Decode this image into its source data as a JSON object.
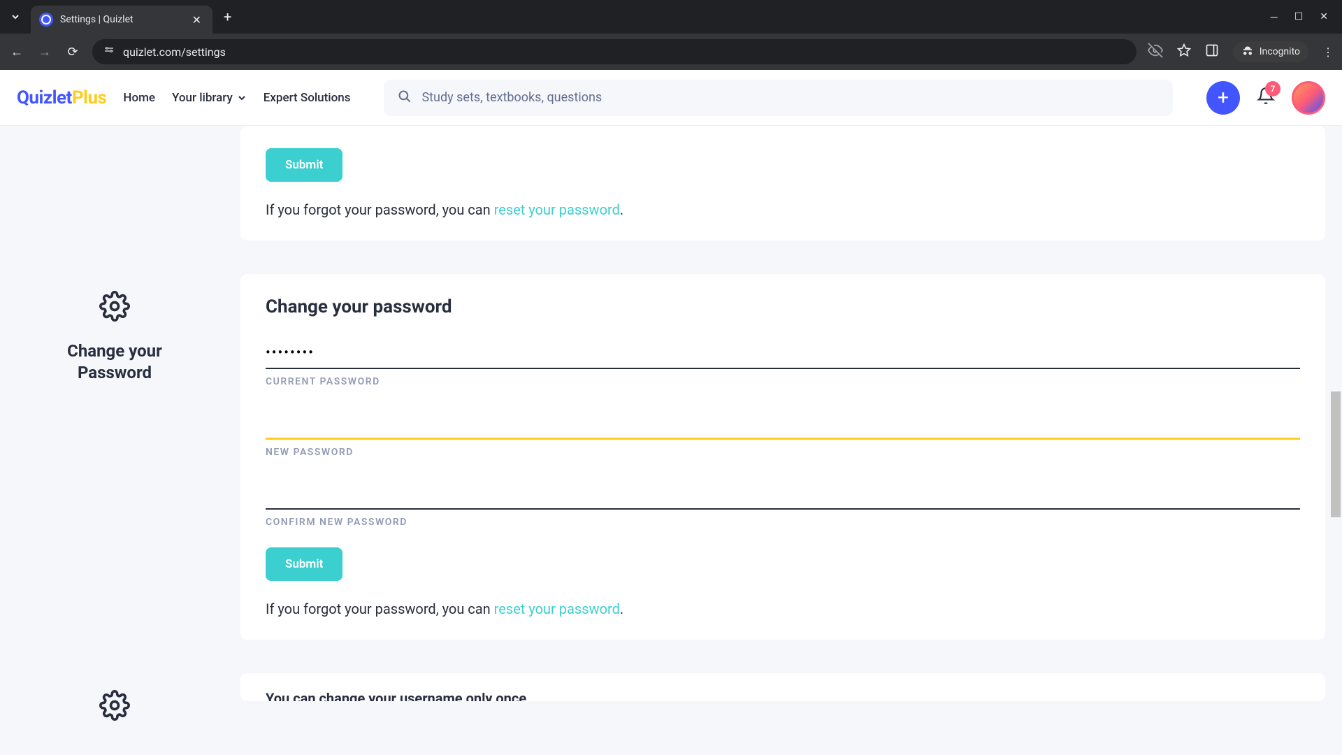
{
  "browser": {
    "tab_title": "Settings | Quizlet",
    "url": "quizlet.com/settings",
    "incognito_label": "Incognito"
  },
  "header": {
    "logo_main": "Quizlet",
    "logo_suffix": "Plus",
    "nav": {
      "home": "Home",
      "library": "Your library",
      "expert": "Expert Solutions"
    },
    "search_placeholder": "Study sets, textbooks, questions",
    "notification_count": "7"
  },
  "partial_card": {
    "submit_label": "Submit",
    "forgot_prefix": "If you forgot your password, you can ",
    "forgot_link": "reset your password",
    "forgot_suffix": "."
  },
  "password_section": {
    "left_title_line1": "Change your",
    "left_title_line2": "Password",
    "heading": "Change your password",
    "current_label": "CURRENT PASSWORD",
    "current_value": "••••••••",
    "new_label": "NEW PASSWORD",
    "confirm_label": "CONFIRM NEW PASSWORD",
    "submit_label": "Submit",
    "forgot_prefix": "If you forgot your password, you can ",
    "forgot_link": "reset your password",
    "forgot_suffix": "."
  },
  "username_peek": {
    "text": "You can change your username only once"
  }
}
